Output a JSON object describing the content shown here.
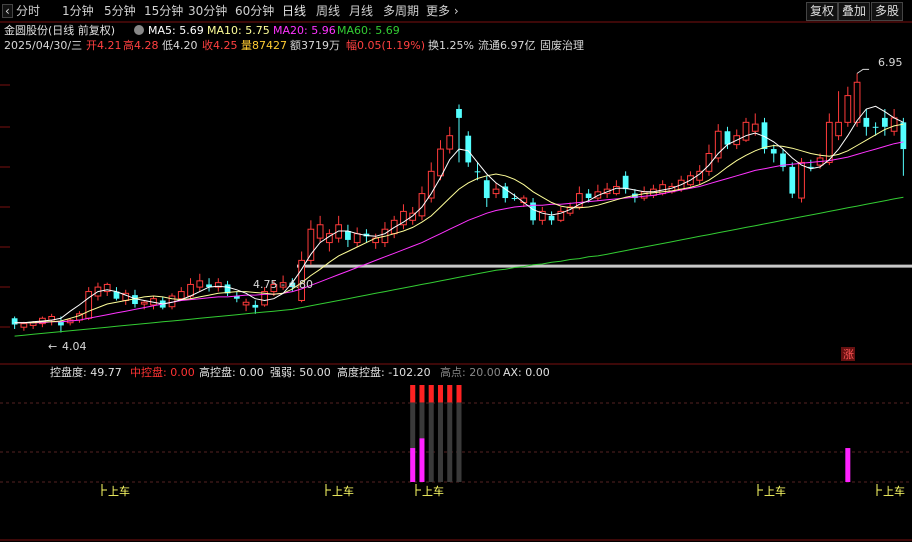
{
  "toolbar": {
    "periods": [
      "分时",
      "1分钟",
      "5分钟",
      "15分钟",
      "30分钟",
      "60分钟",
      "日线",
      "周线",
      "月线",
      "多周期",
      "更多"
    ],
    "active_period": "日线",
    "right_buttons": [
      "复权",
      "叠加",
      "多股"
    ]
  },
  "stock": {
    "title": "金圆股份(日线 前复权)",
    "ma5": "MA5: 5.69",
    "ma10": "MA10: 5.75",
    "ma20": "MA20: 5.96",
    "ma60": "MA60: 5.69"
  },
  "quote": {
    "date": "2025/04/30/三",
    "open": "开4.21",
    "high": "高4.28",
    "low": "低4.20",
    "close": "收4.25",
    "volume": "量87427",
    "amount": "额3719万",
    "change": "幅0.05(1.19%)",
    "turnover": "换1.25%",
    "float_cap": "流通6.97亿",
    "concept": "固废治理"
  },
  "annotations": {
    "high_price": "6.95",
    "low_price": "4.04",
    "zone_label": "4.75 - 4.80",
    "up_badge": "涨"
  },
  "indicator": {
    "kongpandu": "控盘度: 49.77",
    "zhongkongpan": "中控盘: 0.00",
    "gaokongpan": "高控盘: 0.00",
    "qiangruo": "强弱: 50.00",
    "gaodukongpan": "高度控盘: -102.20",
    "gaodian": "高点: 20.00",
    "ax": "AX: 0.00",
    "signal_label": "上车",
    "signals_x": [
      102,
      326,
      416,
      758,
      877
    ]
  },
  "colors": {
    "up": "#ff3b3b",
    "down": "#54ffff",
    "ma5": "#ffffff",
    "ma10": "#ffff99",
    "ma20": "#ff33ff",
    "ma60": "#33cc33",
    "zone": "#c8c8c8"
  },
  "chart_data": {
    "type": "candlestick",
    "y_range": [
      3.9,
      7.1
    ],
    "candles": [
      {
        "o": 4.13,
        "c": 4.2,
        "h": 4.22,
        "l": 4.08,
        "up": false
      },
      {
        "o": 4.1,
        "c": 4.14,
        "h": 4.16,
        "l": 4.06,
        "up": true
      },
      {
        "o": 4.12,
        "c": 4.15,
        "h": 4.17,
        "l": 4.08,
        "up": true
      },
      {
        "o": 4.14,
        "c": 4.2,
        "h": 4.22,
        "l": 4.1,
        "up": true
      },
      {
        "o": 4.18,
        "c": 4.22,
        "h": 4.25,
        "l": 4.12,
        "up": true
      },
      {
        "o": 4.16,
        "c": 4.12,
        "h": 4.22,
        "l": 4.04,
        "up": false
      },
      {
        "o": 4.15,
        "c": 4.18,
        "h": 4.2,
        "l": 4.12,
        "up": true
      },
      {
        "o": 4.18,
        "c": 4.25,
        "h": 4.28,
        "l": 4.15,
        "up": true
      },
      {
        "o": 4.2,
        "c": 4.5,
        "h": 4.55,
        "l": 4.18,
        "up": true
      },
      {
        "o": 4.45,
        "c": 4.55,
        "h": 4.6,
        "l": 4.4,
        "up": true
      },
      {
        "o": 4.5,
        "c": 4.58,
        "h": 4.6,
        "l": 4.45,
        "up": true
      },
      {
        "o": 4.5,
        "c": 4.42,
        "h": 4.55,
        "l": 4.4,
        "up": false
      },
      {
        "o": 4.4,
        "c": 4.48,
        "h": 4.52,
        "l": 4.35,
        "up": true
      },
      {
        "o": 4.46,
        "c": 4.36,
        "h": 4.52,
        "l": 4.32,
        "up": false
      },
      {
        "o": 4.36,
        "c": 4.38,
        "h": 4.4,
        "l": 4.3,
        "up": true
      },
      {
        "o": 4.35,
        "c": 4.42,
        "h": 4.45,
        "l": 4.3,
        "up": true
      },
      {
        "o": 4.4,
        "c": 4.32,
        "h": 4.44,
        "l": 4.3,
        "up": false
      },
      {
        "o": 4.33,
        "c": 4.45,
        "h": 4.48,
        "l": 4.3,
        "up": true
      },
      {
        "o": 4.42,
        "c": 4.5,
        "h": 4.55,
        "l": 4.4,
        "up": true
      },
      {
        "o": 4.45,
        "c": 4.58,
        "h": 4.65,
        "l": 4.42,
        "up": true
      },
      {
        "o": 4.55,
        "c": 4.62,
        "h": 4.7,
        "l": 4.5,
        "up": true
      },
      {
        "o": 4.58,
        "c": 4.55,
        "h": 4.65,
        "l": 4.5,
        "up": false
      },
      {
        "o": 4.55,
        "c": 4.6,
        "h": 4.65,
        "l": 4.5,
        "up": true
      },
      {
        "o": 4.58,
        "c": 4.48,
        "h": 4.62,
        "l": 4.45,
        "up": false
      },
      {
        "o": 4.45,
        "c": 4.42,
        "h": 4.5,
        "l": 4.38,
        "up": false
      },
      {
        "o": 4.35,
        "c": 4.38,
        "h": 4.42,
        "l": 4.28,
        "up": true
      },
      {
        "o": 4.35,
        "c": 4.32,
        "h": 4.4,
        "l": 4.25,
        "up": false
      },
      {
        "o": 4.35,
        "c": 4.5,
        "h": 4.55,
        "l": 4.33,
        "up": true
      },
      {
        "o": 4.5,
        "c": 4.58,
        "h": 4.62,
        "l": 4.45,
        "up": true
      },
      {
        "o": 4.55,
        "c": 4.6,
        "h": 4.68,
        "l": 4.52,
        "up": true
      },
      {
        "o": 4.6,
        "c": 4.55,
        "h": 4.65,
        "l": 4.5,
        "up": false
      },
      {
        "o": 4.4,
        "c": 4.85,
        "h": 4.95,
        "l": 4.38,
        "up": true
      },
      {
        "o": 4.85,
        "c": 5.2,
        "h": 5.3,
        "l": 4.8,
        "up": true
      },
      {
        "o": 5.1,
        "c": 5.25,
        "h": 5.35,
        "l": 5.05,
        "up": true
      },
      {
        "o": 5.05,
        "c": 5.15,
        "h": 5.2,
        "l": 4.95,
        "up": true
      },
      {
        "o": 5.1,
        "c": 5.25,
        "h": 5.35,
        "l": 5.05,
        "up": true
      },
      {
        "o": 5.18,
        "c": 5.08,
        "h": 5.25,
        "l": 5.0,
        "up": false
      },
      {
        "o": 5.05,
        "c": 5.15,
        "h": 5.22,
        "l": 5.0,
        "up": true
      },
      {
        "o": 5.15,
        "c": 5.12,
        "h": 5.2,
        "l": 5.05,
        "up": false
      },
      {
        "o": 5.05,
        "c": 5.1,
        "h": 5.15,
        "l": 4.98,
        "up": true
      },
      {
        "o": 5.05,
        "c": 5.2,
        "h": 5.28,
        "l": 5.0,
        "up": true
      },
      {
        "o": 5.15,
        "c": 5.3,
        "h": 5.35,
        "l": 5.1,
        "up": true
      },
      {
        "o": 5.25,
        "c": 5.4,
        "h": 5.48,
        "l": 5.2,
        "up": true
      },
      {
        "o": 5.3,
        "c": 5.38,
        "h": 5.45,
        "l": 5.25,
        "up": true
      },
      {
        "o": 5.35,
        "c": 5.6,
        "h": 5.68,
        "l": 5.3,
        "up": true
      },
      {
        "o": 5.55,
        "c": 5.85,
        "h": 5.95,
        "l": 5.5,
        "up": true
      },
      {
        "o": 5.8,
        "c": 6.1,
        "h": 6.2,
        "l": 5.75,
        "up": true
      },
      {
        "o": 6.1,
        "c": 6.25,
        "h": 6.35,
        "l": 6.05,
        "up": true
      },
      {
        "o": 6.55,
        "c": 6.45,
        "h": 6.6,
        "l": 5.95,
        "up": false
      },
      {
        "o": 6.25,
        "c": 5.95,
        "h": 6.3,
        "l": 5.9,
        "up": false
      },
      {
        "o": 5.85,
        "c": 5.85,
        "h": 5.95,
        "l": 5.75,
        "up": false
      },
      {
        "o": 5.75,
        "c": 5.55,
        "h": 5.8,
        "l": 5.45,
        "up": false
      },
      {
        "o": 5.6,
        "c": 5.65,
        "h": 5.72,
        "l": 5.55,
        "up": true
      },
      {
        "o": 5.68,
        "c": 5.55,
        "h": 5.72,
        "l": 5.5,
        "up": false
      },
      {
        "o": 5.55,
        "c": 5.55,
        "h": 5.6,
        "l": 5.52,
        "up": false
      },
      {
        "o": 5.5,
        "c": 5.55,
        "h": 5.58,
        "l": 5.45,
        "up": true
      },
      {
        "o": 5.5,
        "c": 5.3,
        "h": 5.55,
        "l": 5.25,
        "up": false
      },
      {
        "o": 5.3,
        "c": 5.4,
        "h": 5.45,
        "l": 5.25,
        "up": true
      },
      {
        "o": 5.35,
        "c": 5.3,
        "h": 5.4,
        "l": 5.25,
        "up": false
      },
      {
        "o": 5.3,
        "c": 5.4,
        "h": 5.45,
        "l": 5.28,
        "up": true
      },
      {
        "o": 5.38,
        "c": 5.45,
        "h": 5.5,
        "l": 5.35,
        "up": true
      },
      {
        "o": 5.45,
        "c": 5.6,
        "h": 5.68,
        "l": 5.42,
        "up": true
      },
      {
        "o": 5.6,
        "c": 5.55,
        "h": 5.65,
        "l": 5.5,
        "up": false
      },
      {
        "o": 5.55,
        "c": 5.62,
        "h": 5.7,
        "l": 5.52,
        "up": true
      },
      {
        "o": 5.6,
        "c": 5.65,
        "h": 5.72,
        "l": 5.55,
        "up": true
      },
      {
        "o": 5.6,
        "c": 5.68,
        "h": 5.75,
        "l": 5.58,
        "up": true
      },
      {
        "o": 5.8,
        "c": 5.65,
        "h": 5.85,
        "l": 5.6,
        "up": false
      },
      {
        "o": 5.6,
        "c": 5.55,
        "h": 5.65,
        "l": 5.5,
        "up": false
      },
      {
        "o": 5.55,
        "c": 5.62,
        "h": 5.68,
        "l": 5.52,
        "up": true
      },
      {
        "o": 5.58,
        "c": 5.65,
        "h": 5.7,
        "l": 5.55,
        "up": true
      },
      {
        "o": 5.6,
        "c": 5.7,
        "h": 5.75,
        "l": 5.58,
        "up": true
      },
      {
        "o": 5.62,
        "c": 5.68,
        "h": 5.72,
        "l": 5.6,
        "up": true
      },
      {
        "o": 5.65,
        "c": 5.75,
        "h": 5.8,
        "l": 5.62,
        "up": true
      },
      {
        "o": 5.7,
        "c": 5.8,
        "h": 5.85,
        "l": 5.68,
        "up": true
      },
      {
        "o": 5.75,
        "c": 5.85,
        "h": 5.92,
        "l": 5.7,
        "up": true
      },
      {
        "o": 5.85,
        "c": 6.05,
        "h": 6.15,
        "l": 5.8,
        "up": true
      },
      {
        "o": 6.0,
        "c": 6.3,
        "h": 6.38,
        "l": 5.95,
        "up": true
      },
      {
        "o": 6.3,
        "c": 6.15,
        "h": 6.35,
        "l": 6.1,
        "up": false
      },
      {
        "o": 6.15,
        "c": 6.25,
        "h": 6.32,
        "l": 6.1,
        "up": true
      },
      {
        "o": 6.2,
        "c": 6.4,
        "h": 6.45,
        "l": 6.18,
        "up": true
      },
      {
        "o": 6.3,
        "c": 6.38,
        "h": 6.5,
        "l": 6.25,
        "up": true
      },
      {
        "o": 6.4,
        "c": 6.1,
        "h": 6.45,
        "l": 6.05,
        "up": false
      },
      {
        "o": 6.1,
        "c": 6.05,
        "h": 6.15,
        "l": 5.95,
        "up": false
      },
      {
        "o": 6.05,
        "c": 5.9,
        "h": 6.1,
        "l": 5.85,
        "up": false
      },
      {
        "o": 5.9,
        "c": 5.6,
        "h": 5.95,
        "l": 5.55,
        "up": false
      },
      {
        "o": 5.55,
        "c": 5.95,
        "h": 6.0,
        "l": 5.5,
        "up": true
      },
      {
        "o": 5.9,
        "c": 5.9,
        "h": 5.98,
        "l": 5.85,
        "up": false
      },
      {
        "o": 5.92,
        "c": 6.0,
        "h": 6.05,
        "l": 5.88,
        "up": true
      },
      {
        "o": 5.95,
        "c": 6.4,
        "h": 6.5,
        "l": 5.92,
        "up": true
      },
      {
        "o": 6.25,
        "c": 6.4,
        "h": 6.75,
        "l": 6.2,
        "up": true
      },
      {
        "o": 6.4,
        "c": 6.7,
        "h": 6.8,
        "l": 6.35,
        "up": true
      },
      {
        "o": 6.4,
        "c": 6.85,
        "h": 6.95,
        "l": 6.35,
        "up": true
      },
      {
        "o": 6.45,
        "c": 6.35,
        "h": 6.55,
        "l": 6.25,
        "up": false
      },
      {
        "o": 6.35,
        "c": 6.35,
        "h": 6.4,
        "l": 6.25,
        "up": false
      },
      {
        "o": 6.45,
        "c": 6.35,
        "h": 6.55,
        "l": 6.25,
        "up": false
      },
      {
        "o": 6.3,
        "c": 6.45,
        "h": 6.55,
        "l": 6.25,
        "up": true
      },
      {
        "o": 6.4,
        "c": 6.1,
        "h": 6.45,
        "l": 5.8,
        "up": false
      }
    ],
    "ma5": [
      4.15,
      4.15,
      4.16,
      4.17,
      4.18,
      4.2,
      4.28,
      4.35,
      4.43,
      4.5,
      4.52,
      4.5,
      4.46,
      4.42,
      4.4,
      4.38,
      4.36,
      4.38,
      4.41,
      4.45,
      4.5,
      4.55,
      4.56,
      4.55,
      4.52,
      4.48,
      4.42,
      4.4,
      4.42,
      4.48,
      4.6,
      4.75,
      4.92,
      5.05,
      5.12,
      5.18,
      5.18,
      5.15,
      5.13,
      5.12,
      5.15,
      5.22,
      5.28,
      5.35,
      5.45,
      5.6,
      5.78,
      5.98,
      6.1,
      6.08,
      5.95,
      5.82,
      5.72,
      5.65,
      5.58,
      5.5,
      5.42,
      5.38,
      5.36,
      5.38,
      5.42,
      5.48,
      5.52,
      5.58,
      5.62,
      5.66,
      5.66,
      5.64,
      5.62,
      5.62,
      5.64,
      5.66,
      5.7,
      5.75,
      5.82,
      5.92,
      6.05,
      6.15,
      6.2,
      6.25,
      6.28,
      6.24,
      6.18,
      6.1,
      6.0,
      5.92,
      5.88,
      5.9,
      5.98,
      6.1,
      6.25,
      6.42,
      6.55,
      6.58,
      6.52,
      6.45,
      6.4
    ],
    "ma10": [
      4.15,
      4.15,
      4.15,
      4.16,
      4.16,
      4.17,
      4.2,
      4.23,
      4.28,
      4.32,
      4.36,
      4.38,
      4.4,
      4.42,
      4.44,
      4.45,
      4.44,
      4.42,
      4.41,
      4.42,
      4.44,
      4.46,
      4.48,
      4.49,
      4.5,
      4.5,
      4.49,
      4.48,
      4.47,
      4.48,
      4.53,
      4.6,
      4.68,
      4.75,
      4.83,
      4.9,
      4.95,
      5.0,
      5.05,
      5.1,
      5.12,
      5.15,
      5.18,
      5.22,
      5.28,
      5.35,
      5.45,
      5.55,
      5.65,
      5.72,
      5.77,
      5.8,
      5.82,
      5.8,
      5.76,
      5.7,
      5.62,
      5.56,
      5.5,
      5.46,
      5.44,
      5.44,
      5.45,
      5.47,
      5.5,
      5.53,
      5.56,
      5.58,
      5.6,
      5.61,
      5.62,
      5.63,
      5.65,
      5.67,
      5.7,
      5.75,
      5.82,
      5.9,
      5.97,
      6.03,
      6.08,
      6.12,
      6.14,
      6.13,
      6.11,
      6.08,
      6.05,
      6.03,
      6.02,
      6.04,
      6.08,
      6.14,
      6.2,
      6.26,
      6.32,
      6.36,
      6.38
    ],
    "ma20": [
      4.15,
      4.15,
      4.15,
      4.15,
      4.16,
      4.16,
      4.17,
      4.18,
      4.2,
      4.22,
      4.24,
      4.26,
      4.28,
      4.3,
      4.32,
      4.34,
      4.36,
      4.38,
      4.4,
      4.41,
      4.42,
      4.43,
      4.44,
      4.44,
      4.45,
      4.46,
      4.46,
      4.47,
      4.47,
      4.48,
      4.5,
      4.53,
      4.57,
      4.61,
      4.65,
      4.69,
      4.73,
      4.77,
      4.81,
      4.85,
      4.89,
      4.93,
      4.97,
      5.01,
      5.05,
      5.1,
      5.15,
      5.2,
      5.25,
      5.3,
      5.34,
      5.38,
      5.41,
      5.43,
      5.45,
      5.46,
      5.47,
      5.47,
      5.48,
      5.48,
      5.49,
      5.5,
      5.51,
      5.52,
      5.53,
      5.54,
      5.55,
      5.56,
      5.57,
      5.58,
      5.6,
      5.62,
      5.64,
      5.66,
      5.68,
      5.71,
      5.74,
      5.77,
      5.8,
      5.83,
      5.86,
      5.88,
      5.9,
      5.92,
      5.93,
      5.94,
      5.95,
      5.96,
      5.97,
      5.99,
      6.01,
      6.04,
      6.07,
      6.1,
      6.13,
      6.16,
      6.18
    ],
    "ma60": [
      4.0,
      4.01,
      4.02,
      4.03,
      4.04,
      4.05,
      4.06,
      4.07,
      4.08,
      4.09,
      4.1,
      4.11,
      4.12,
      4.13,
      4.14,
      4.15,
      4.16,
      4.17,
      4.18,
      4.19,
      4.2,
      4.21,
      4.22,
      4.23,
      4.24,
      4.25,
      4.26,
      4.27,
      4.28,
      4.29,
      4.3,
      4.32,
      4.34,
      4.36,
      4.38,
      4.4,
      4.42,
      4.44,
      4.46,
      4.48,
      4.5,
      4.52,
      4.54,
      4.56,
      4.58,
      4.6,
      4.62,
      4.64,
      4.66,
      4.68,
      4.7,
      4.72,
      4.74,
      4.75,
      4.77,
      4.78,
      4.8,
      4.81,
      4.83,
      4.84,
      4.86,
      4.87,
      4.89,
      4.9,
      4.92,
      4.94,
      4.96,
      4.98,
      5.0,
      5.02,
      5.04,
      5.06,
      5.08,
      5.1,
      5.12,
      5.14,
      5.16,
      5.18,
      5.2,
      5.22,
      5.24,
      5.26,
      5.28,
      5.3,
      5.32,
      5.34,
      5.36,
      5.38,
      5.4,
      5.42,
      5.44,
      5.46,
      5.48,
      5.5,
      5.52,
      5.54,
      5.56
    ],
    "zone_price": 4.78,
    "indicator_bars": [
      {
        "index": 43,
        "red": 1.0,
        "magenta": 0.35
      },
      {
        "index": 44,
        "red": 1.0,
        "magenta": 0.45
      },
      {
        "index": 45,
        "red": 1.0,
        "magenta": 0.0
      },
      {
        "index": 46,
        "red": 1.0,
        "magenta": 0.0
      },
      {
        "index": 47,
        "red": 1.0,
        "magenta": 0.0
      },
      {
        "index": 48,
        "red": 1.0,
        "magenta": 0.0
      },
      {
        "index": 90,
        "red": 0.0,
        "magenta": 0.35
      }
    ]
  }
}
